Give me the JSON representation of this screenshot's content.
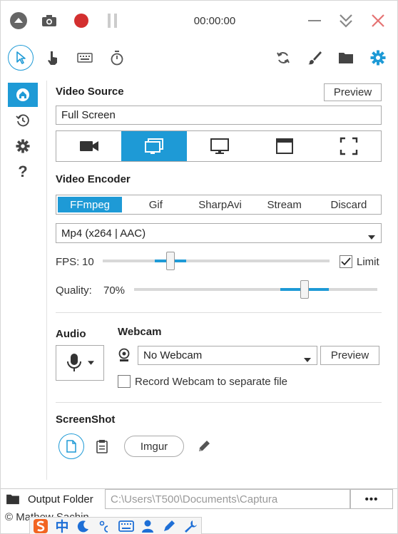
{
  "titlebar": {
    "timer": "00:00:00"
  },
  "video": {
    "heading": "Video Source",
    "preview_label": "Preview",
    "source_value": "Full Screen"
  },
  "encoder": {
    "heading": "Video Encoder",
    "tabs": [
      "FFmpeg",
      "Gif",
      "SharpAvi",
      "Stream",
      "Discard"
    ],
    "selected_tab": "FFmpeg",
    "codec": "Mp4 (x264 | AAC)",
    "fps_label": "FPS:",
    "fps_value": "10",
    "fps_level": 0.3,
    "limit_label": "Limit",
    "limit_checked": true,
    "quality_label": "Quality:",
    "quality_value": "70%",
    "quality_level": 0.7
  },
  "audio": {
    "heading": "Audio"
  },
  "webcam": {
    "heading": "Webcam",
    "selected": "No Webcam",
    "preview_label": "Preview",
    "separate_label": "Record Webcam to separate file",
    "separate_checked": false
  },
  "screenshot": {
    "heading": "ScreenShot",
    "imgur_label": "Imgur"
  },
  "output": {
    "label": "Output Folder",
    "path": "C:\\Users\\T500\\Documents\\Captura",
    "more": "•••"
  },
  "footer": {
    "copyright": "© Mathew Sachin"
  },
  "ime": {
    "ime_char": "中"
  },
  "colors": {
    "accent": "#1e9ad6",
    "record": "#d32f2f",
    "close": "#e57373"
  }
}
